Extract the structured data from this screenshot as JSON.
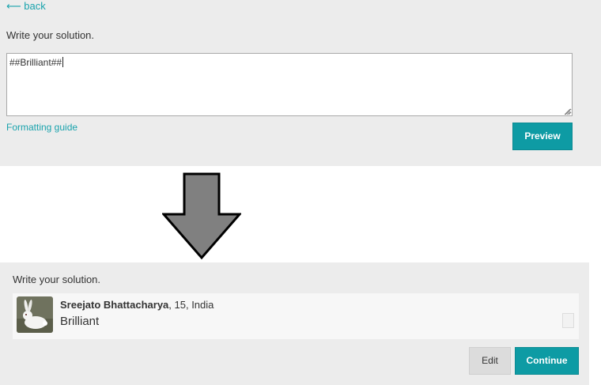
{
  "editor": {
    "back_label": "⟵ back",
    "prompt": "Write your solution.",
    "textarea_value": "##Brilliant##",
    "formatting_label": "Formatting guide",
    "preview_label": "Preview"
  },
  "transition_icon": "down-arrow-icon",
  "preview": {
    "prompt": "Write your solution.",
    "author_name": "Sreejato Bhattacharya",
    "author_details": ", 15, India",
    "avatar_icon": "rabbit-avatar",
    "solution_text": "Brilliant",
    "edit_label": "Edit",
    "continue_label": "Continue"
  },
  "colors": {
    "accent": "#0e9ba4",
    "link": "#1aa3ad",
    "panel": "#ececec",
    "arrow": "#808080"
  }
}
